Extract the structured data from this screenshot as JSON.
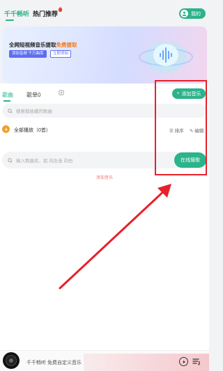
{
  "header": {
    "tab_active": "千千畅听",
    "tab_hot": "热门推荐",
    "mine_label": "我的"
  },
  "banner": {
    "title_prefix": "全网短视频音乐提取",
    "title_highlight": "免费提取",
    "btn_primary": "添加音频 千万曲库",
    "btn_secondary": "立即添加"
  },
  "library": {
    "tab_songs": "歌曲",
    "tab_playlists": "歌单0",
    "add_music_label": "添加音乐",
    "search_placeholder": "搜索我收藏的歌曲",
    "play_all_label": "全部播放（0首）",
    "sort_label": "排序",
    "edit_label": "编辑",
    "online_search_placeholder": "输入歌曲名、如 向左走 向右",
    "online_search_button": "在线搜歌",
    "add_music_link": "添加音乐"
  },
  "player": {
    "now_playing": "千千畅听 免费自定义音乐"
  },
  "colors": {
    "accent": "#2bb38a",
    "highlight": "#e8202a",
    "warning": "#f0a030"
  }
}
